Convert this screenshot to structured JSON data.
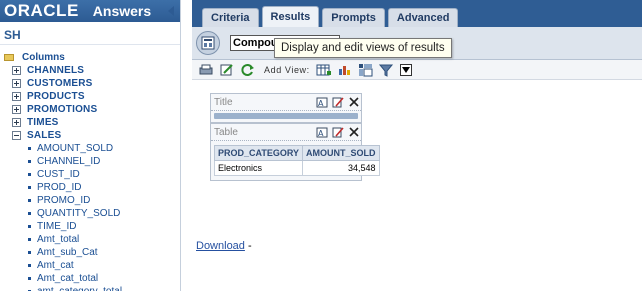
{
  "header": {
    "brand": "ORACLE",
    "product": "Answers"
  },
  "subject_area": "SH",
  "tree": {
    "root": "Columns",
    "folders": [
      {
        "label": "CHANNELS",
        "expanded": false
      },
      {
        "label": "CUSTOMERS",
        "expanded": false
      },
      {
        "label": "PRODUCTS",
        "expanded": false
      },
      {
        "label": "PROMOTIONS",
        "expanded": false
      },
      {
        "label": "TIMES",
        "expanded": false
      },
      {
        "label": "SALES",
        "expanded": true
      }
    ],
    "sales_columns": [
      "AMOUNT_SOLD",
      "CHANNEL_ID",
      "CUST_ID",
      "PROD_ID",
      "PROMO_ID",
      "QUANTITY_SOLD",
      "TIME_ID",
      "Amt_total",
      "Amt_sub_Cat",
      "Amt_cat",
      "Amt_cat_total",
      "amt_category_total"
    ]
  },
  "tabs": [
    {
      "label": "Criteria",
      "active": false
    },
    {
      "label": "Results",
      "active": true
    },
    {
      "label": "Prompts",
      "active": false
    },
    {
      "label": "Advanced",
      "active": false
    }
  ],
  "view_select": {
    "value": "Compou"
  },
  "tooltip": "Display and edit views of results",
  "toolbar": {
    "add_view_label": "Add View:"
  },
  "views": {
    "title_view": {
      "label": "Title"
    },
    "table_view": {
      "label": "Table",
      "columns": [
        "PROD_CATEGORY",
        "AMOUNT_SOLD"
      ],
      "rows": [
        [
          "Electronics",
          "34,548"
        ]
      ]
    }
  },
  "download": {
    "label": "Download",
    "suffix": " -"
  },
  "colors": {
    "header_blue": "#2f5d94",
    "link_blue": "#1b4f93"
  }
}
